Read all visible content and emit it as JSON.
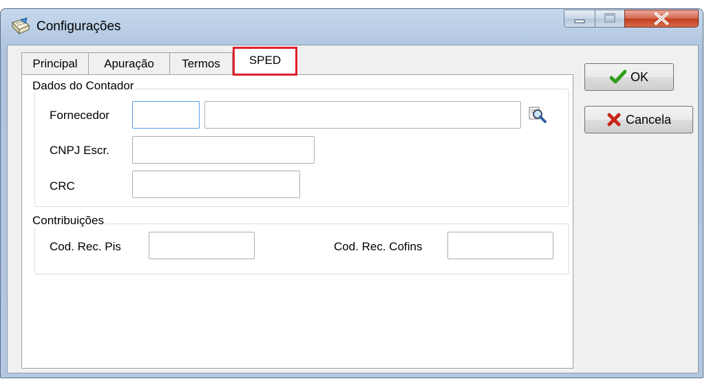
{
  "window": {
    "title": "Configurações",
    "icons": {
      "app": "notepad-pencil-icon",
      "minimize": "minimize-icon",
      "maximize": "maximize-icon",
      "close": "close-icon"
    }
  },
  "tabs": [
    {
      "label": "Principal"
    },
    {
      "label": "Apuração"
    },
    {
      "label": "Termos"
    },
    {
      "label": "SPED",
      "active": true
    }
  ],
  "highlight_color": "#e0202a",
  "dados_contador": {
    "title": "Dados do Contador",
    "fornecedor_label": "Fornecedor",
    "fornecedor_code": "",
    "fornecedor_name": "",
    "search_icon": "magnifier-search-icon",
    "cnpj_label": "CNPJ Escr.",
    "cnpj_value": "",
    "crc_label": "CRC",
    "crc_value": ""
  },
  "contribuicoes": {
    "title": "Contribuições",
    "pis_label": "Cod. Rec. Pis",
    "pis_value": "",
    "cofins_label": "Cod. Rec. Cofins",
    "cofins_value": ""
  },
  "buttons": {
    "ok_label": "OK",
    "ok_icon": "green-check-icon",
    "cancel_label": "Cancela",
    "cancel_icon": "red-x-icon"
  }
}
